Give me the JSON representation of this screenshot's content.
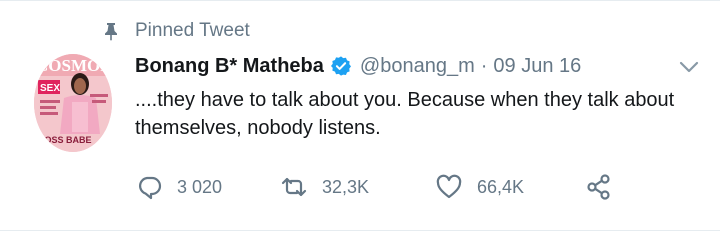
{
  "pinned": {
    "label": "Pinned Tweet"
  },
  "tweet": {
    "display_name": "Bonang B* Matheba",
    "handle": "@bonang_m",
    "separator": "·",
    "date": "09 Jun 16",
    "text": "....they have to talk about you. Because when they talk about themselves, nobody listens.",
    "avatar_texts": {
      "masthead": "COSMOPOLITAN",
      "sex": "SEX",
      "cover_line": "BOSS BABE"
    }
  },
  "actions": {
    "reply": {
      "count": "3 020",
      "icon": "reply-icon"
    },
    "retweet": {
      "count": "32,3K",
      "icon": "retweet-icon"
    },
    "like": {
      "count": "66,4K",
      "icon": "heart-icon"
    },
    "share": {
      "icon": "share-icon"
    }
  },
  "colors": {
    "text_primary": "#14171a",
    "text_secondary": "#657786",
    "verified_blue": "#1da1f2",
    "divider": "#e6ecf0"
  }
}
